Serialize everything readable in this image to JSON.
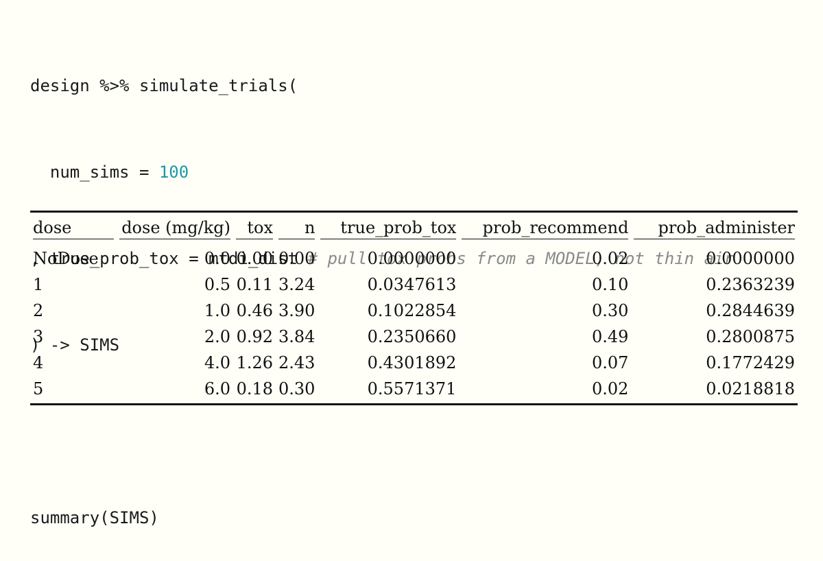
{
  "code": {
    "line1": "design %>% simulate_trials(",
    "line2_prefix": "  num_sims = ",
    "line2_num": "100",
    "line3_prefix": ", true_prob_tox = mtdi_dist ",
    "line3_comment": "# pull tox probs from a MODEL, not thin air",
    "line4": ") -> SIMS",
    "line6": "summary(SIMS)"
  },
  "table": {
    "headers": [
      "dose",
      "dose (mg/kg)",
      "tox",
      "n",
      "true_prob_tox",
      "prob_recommend",
      "prob_administer"
    ],
    "rows": [
      [
        "NoDose",
        "0.0",
        "0.00",
        "0.00",
        "0.0000000",
        "0.02",
        "0.0000000"
      ],
      [
        "1",
        "0.5",
        "0.11",
        "3.24",
        "0.0347613",
        "0.10",
        "0.2363239"
      ],
      [
        "2",
        "1.0",
        "0.46",
        "3.90",
        "0.1022854",
        "0.30",
        "0.2844639"
      ],
      [
        "3",
        "2.0",
        "0.92",
        "3.84",
        "0.2350660",
        "0.49",
        "0.2800875"
      ],
      [
        "4",
        "4.0",
        "1.26",
        "2.43",
        "0.4301892",
        "0.07",
        "0.1772429"
      ],
      [
        "5",
        "6.0",
        "0.18",
        "0.30",
        "0.5571371",
        "0.02",
        "0.0218818"
      ]
    ]
  },
  "colors": {
    "background": "#fffff8",
    "number": "#1a9aa6",
    "comment": "#8a8a8a",
    "text": "#1a1a1a"
  }
}
